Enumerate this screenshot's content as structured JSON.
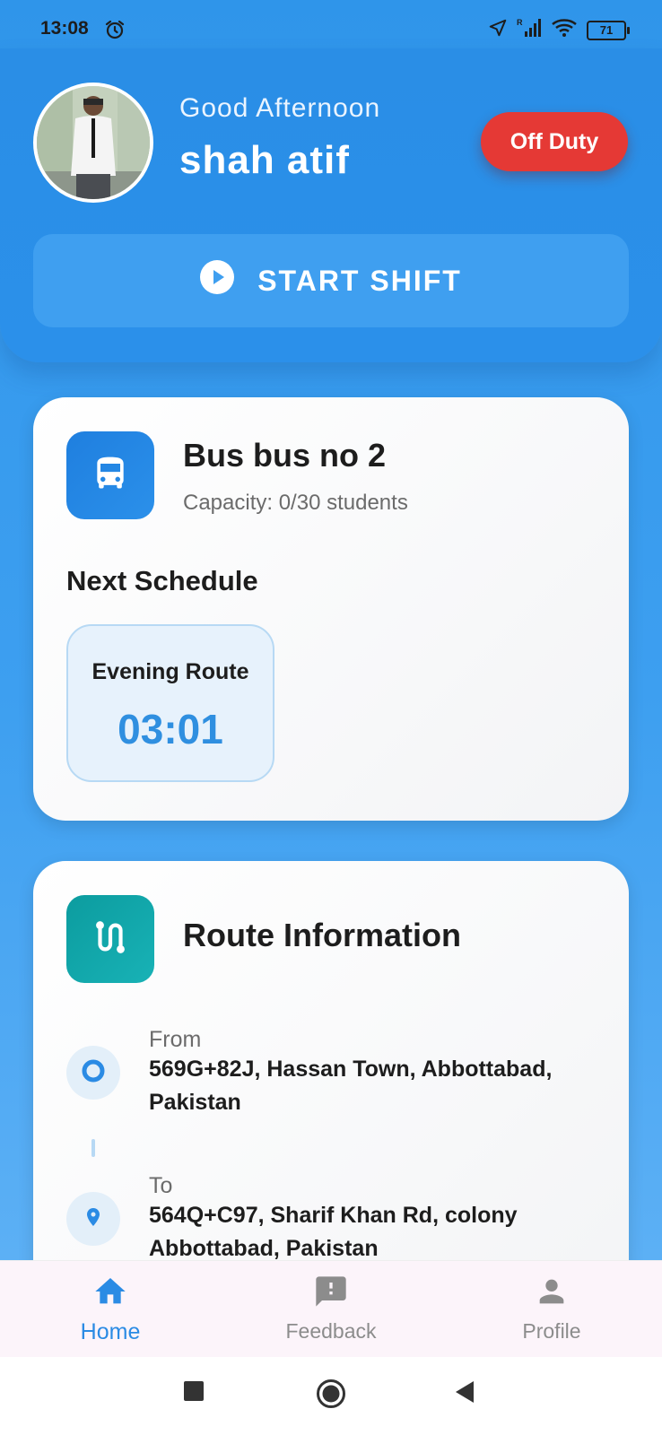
{
  "status_bar": {
    "time": "13:08",
    "battery": "71",
    "icons": [
      "alarm-icon",
      "location-arrow-icon",
      "signal-icon",
      "wifi-icon",
      "battery-icon"
    ]
  },
  "header": {
    "greeting": "Good Afternoon",
    "user_name": "shah atif",
    "duty_status": "Off Duty",
    "start_shift_label": "START SHIFT",
    "colors": {
      "header": "#2b90ea",
      "duty_badge": "#e53935"
    }
  },
  "bus_card": {
    "title": "Bus bus no 2",
    "capacity": "Capacity: 0/30 students",
    "next_schedule_heading": "Next Schedule",
    "schedule": {
      "name": "Evening Route",
      "time": "03:01"
    }
  },
  "route_card": {
    "title": "Route Information",
    "from_label": "From",
    "from_address": "569G+82J, Hassan Town, Abbottabad, Pakistan",
    "to_label": "To",
    "to_address": "564Q+C97, Sharif Khan Rd, colony Abbottabad, Pakistan"
  },
  "bottom_nav": {
    "items": [
      {
        "label": "Home",
        "icon": "home-icon",
        "active": true
      },
      {
        "label": "Feedback",
        "icon": "feedback-icon",
        "active": false
      },
      {
        "label": "Profile",
        "icon": "person-icon",
        "active": false
      }
    ]
  }
}
